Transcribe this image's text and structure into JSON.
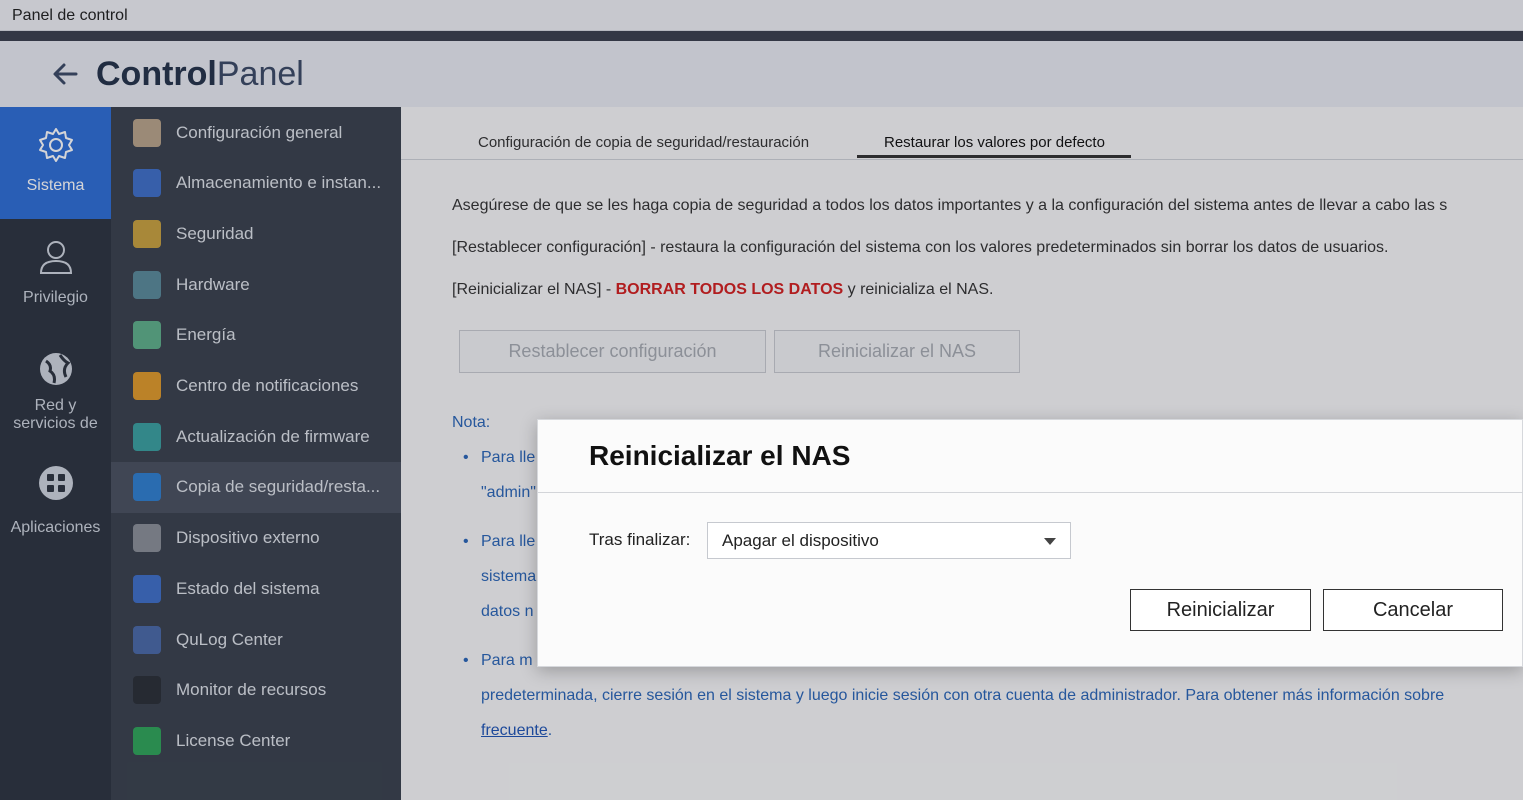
{
  "window": {
    "title": "Panel de control"
  },
  "header": {
    "brand_bold": "Control",
    "brand_light": "Panel"
  },
  "rail": [
    {
      "label": "Sistema"
    },
    {
      "label": "Privilegio"
    },
    {
      "label_line1": "Red y",
      "label_line2": "servicios de"
    },
    {
      "label": "Aplicaciones"
    }
  ],
  "menu": [
    {
      "label": "Configuración general",
      "color": "#b9a48a"
    },
    {
      "label": "Almacenamiento e instan...",
      "color": "#3f6fc9"
    },
    {
      "label": "Seguridad",
      "color": "#c9a23f"
    },
    {
      "label": "Hardware",
      "color": "#5a8a9a"
    },
    {
      "label": "Energía",
      "color": "#5fb08a"
    },
    {
      "label": "Centro de notificaciones",
      "color": "#e09a2a"
    },
    {
      "label": "Actualización de firmware",
      "color": "#3aa0a0"
    },
    {
      "label": "Copia de seguridad/resta...",
      "color": "#2f7fd0"
    },
    {
      "label": "Dispositivo externo",
      "color": "#8a8f98"
    },
    {
      "label": "Estado del sistema",
      "color": "#3f6fc9"
    },
    {
      "label": "QuLog Center",
      "color": "#4a6aa8"
    },
    {
      "label": "Monitor de recursos",
      "color": "#2a2f36"
    },
    {
      "label": "License Center",
      "color": "#2fa55a"
    }
  ],
  "tabs": [
    {
      "label": "Configuración de copia de seguridad/restauración"
    },
    {
      "label": "Restaurar los valores por defecto"
    }
  ],
  "content": {
    "para1": "Asegúrese de que se les haga copia de seguridad a todos los datos importantes y a la configuración del sistema antes de llevar a cabo las s",
    "para2": "[Restablecer configuración] - restaura la configuración del sistema con los valores predeterminados sin borrar los datos de usuarios.",
    "para3_pre": "[Reinicializar el NAS] - ",
    "para3_red": "BORRAR TODOS LOS DATOS",
    "para3_post": " y reinicializa el NAS.",
    "btn_reset": "Restablecer configuración",
    "btn_reinit": "Reinicializar el NAS",
    "note_label": "Nota:",
    "b1_l1": "Para lle",
    "b1_l2": "\"admin\"",
    "b2_l1": "Para lle",
    "b2_l2": "sistema",
    "b2_l3": "datos n",
    "b3_l1": "Para m",
    "b3_l2": "predeterminada, cierre sesión en el sistema y luego inicie sesión con otra cuenta de administrador. Para obtener más información sobre",
    "b3_link": "frecuente",
    "b3_tail": "."
  },
  "dialog": {
    "title": "Reinicializar el NAS",
    "after_label": "Tras finalizar:",
    "select_value": "Apagar el dispositivo",
    "btn_confirm": "Reinicializar",
    "btn_cancel": "Cancelar"
  }
}
